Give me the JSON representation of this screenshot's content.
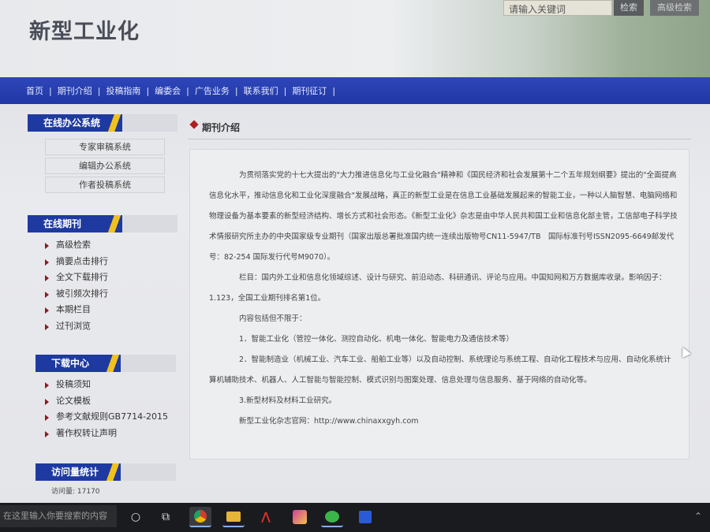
{
  "site": {
    "title": "新型工业化"
  },
  "search": {
    "placeholder": "请输入关键词",
    "button": "检索",
    "advanced": "高级检索"
  },
  "nav": [
    "首页",
    "期刊介绍",
    "投稿指南",
    "编委会",
    "广告业务",
    "联系我们",
    "期刊征订"
  ],
  "sidebar": {
    "office": {
      "title": "在线办公系统",
      "items": [
        "专家审稿系统",
        "编辑办公系统",
        "作者投稿系统"
      ]
    },
    "journal": {
      "title": "在线期刊",
      "items": [
        "高级检索",
        "摘要点击排行",
        "全文下载排行",
        "被引频次排行",
        "本期栏目",
        "过刊浏览"
      ]
    },
    "download": {
      "title": "下载中心",
      "items": [
        "投稿须知",
        "论文模板",
        "参考文献规则GB7714-2015",
        "著作权转让声明"
      ]
    },
    "visits": {
      "title": "访问量统计",
      "text": "访问量: 17170"
    }
  },
  "main": {
    "title": "期刊介绍",
    "paragraphs": [
      "为贯彻落实党的十七大提出的\"大力推进信息化与工业化融合\"精神和《国民经济和社会发展第十二个五年规划纲要》提出的\"全面提高信息化水平，推动信息化和工业化深度融合\"发展战略，真正的新型工业是在信息工业基础发展起来的智能工业，一种以人脑智慧、电脑网络和物理设备为基本要素的新型经济结构、增长方式和社会形态。《新型工业化》杂志是由中华人民共和国工业和信息化部主管，工信部电子科学技术情报研究所主办的中央国家级专业期刊（国家出版总署批准国内统一连续出版物号CN11-5947/TB　国际标准刊号ISSN2095-6649邮发代号：82-254 国际发行代号M9070）。",
      "栏目：国内外工业和信息化领域综述、设计与研究、前沿动态、科研通讯、评论与应用。中国知网和万方数据库收录。影响因子：1.123，全国工业期刊排名第1位。",
      "内容包括但不限于：",
      "1．智能工业化（管控一体化、测控自动化、机电一体化、智能电力及通信技术等）",
      "2．智能制造业（机械工业、汽车工业、船舶工业等）以及自动控制、系统理论与系统工程、自动化工程技术与应用、自动化系统计算机辅助技术、机器人、人工智能与智能控制、模式识别与图案处理、信息处理与信息服务、基于网络的自动化等。",
      "3.新型材料及材料工业研究。",
      "新型工业化杂志官网：http://www.chinaxxgyh.com"
    ]
  },
  "taskbar": {
    "search_placeholder": "在这里输入你要搜索的内容"
  }
}
